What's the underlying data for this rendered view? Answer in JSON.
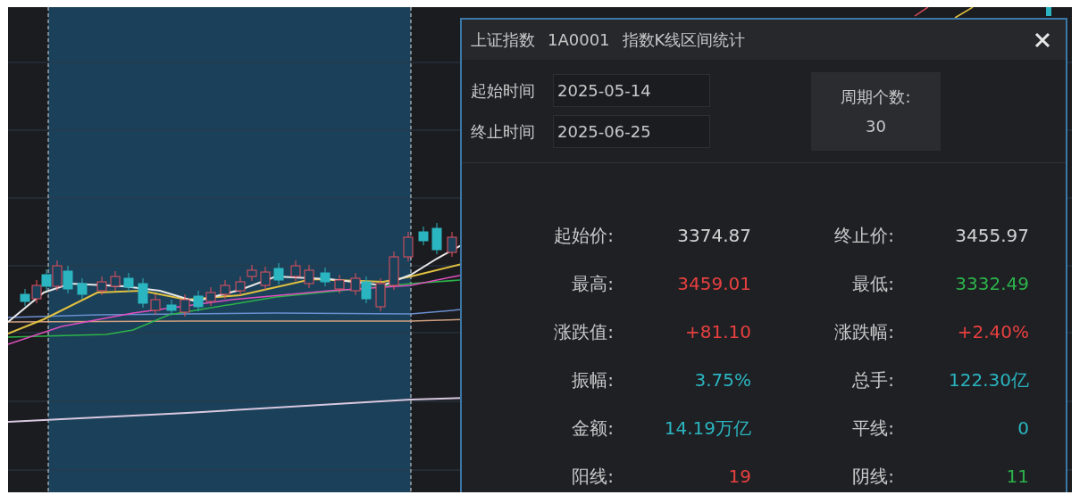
{
  "dialog": {
    "title": [
      "上证指数",
      "1A0001",
      "指数K线区间统计"
    ],
    "time_fields": [
      {
        "label": "起始时间",
        "value": "2025-05-14"
      },
      {
        "label": "终止时间",
        "value": "2025-06-25"
      }
    ],
    "period": {
      "label": "周期个数:",
      "value": "30"
    },
    "stats": [
      {
        "label": "起始价:",
        "value": "3374.87",
        "color": "#d2d2d2"
      },
      {
        "label": "终止价:",
        "value": "3455.97",
        "color": "#d2d2d2"
      },
      {
        "label": "最高:",
        "value": "3459.01",
        "color": "#e8403f"
      },
      {
        "label": "最低:",
        "value": "3332.49",
        "color": "#2db34a"
      },
      {
        "label": "涨跌值:",
        "value": "+81.10",
        "color": "#e8403f"
      },
      {
        "label": "涨跌幅:",
        "value": "+2.40%",
        "color": "#e8403f"
      },
      {
        "label": "振幅:",
        "value": "3.75%",
        "color": "#2bb5c0"
      },
      {
        "label": "总手:",
        "value": "122.30亿",
        "color": "#2bb5c0"
      },
      {
        "label": "金额:",
        "value": "14.19万亿",
        "color": "#2bb5c0"
      },
      {
        "label": "平线:",
        "value": "0",
        "color": "#2bb5c0"
      },
      {
        "label": "阳线:",
        "value": "19",
        "color": "#e8403f"
      },
      {
        "label": "阴线:",
        "value": "11",
        "color": "#2db34a"
      }
    ]
  }
}
